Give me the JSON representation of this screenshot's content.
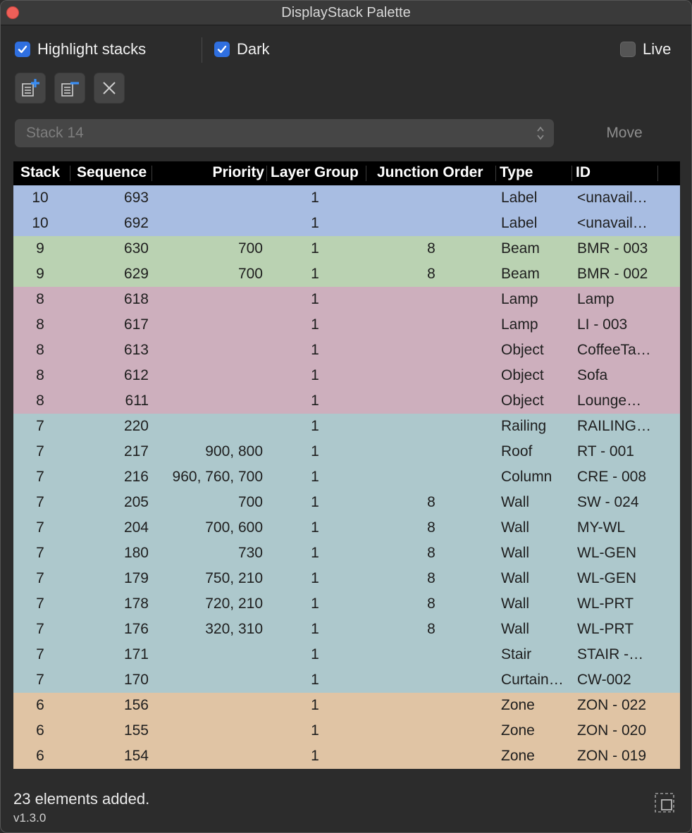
{
  "window": {
    "title": "DisplayStack Palette"
  },
  "options": {
    "highlight_stacks": {
      "label": "Highlight stacks",
      "checked": true
    },
    "dark": {
      "label": "Dark",
      "checked": true
    },
    "live": {
      "label": "Live",
      "checked": false
    }
  },
  "toolbar": {
    "add_icon": "add-to-stack-icon",
    "remove_icon": "remove-from-stack-icon",
    "clear_icon": "close-icon"
  },
  "stack_select": {
    "value": "Stack 14"
  },
  "move_button": {
    "label": "Move"
  },
  "table": {
    "columns": [
      "Stack",
      "Sequence",
      "Priority",
      "Layer Group",
      "Junction Order",
      "Type",
      "ID"
    ],
    "stack_colors": {
      "10": "#a8bde2",
      "9": "#bad2b2",
      "8": "#cdafbd",
      "7": "#adc8cc",
      "6": "#e0c4a4"
    },
    "rows": [
      {
        "stack": "10",
        "sequence": "693",
        "priority": "",
        "layer_group": "1",
        "junction_order": "",
        "type": "Label",
        "id": "<unavail…"
      },
      {
        "stack": "10",
        "sequence": "692",
        "priority": "",
        "layer_group": "1",
        "junction_order": "",
        "type": "Label",
        "id": "<unavail…"
      },
      {
        "stack": "9",
        "sequence": "630",
        "priority": "700",
        "layer_group": "1",
        "junction_order": "8",
        "type": "Beam",
        "id": "BMR - 003"
      },
      {
        "stack": "9",
        "sequence": "629",
        "priority": "700",
        "layer_group": "1",
        "junction_order": "8",
        "type": "Beam",
        "id": "BMR - 002"
      },
      {
        "stack": "8",
        "sequence": "618",
        "priority": "",
        "layer_group": "1",
        "junction_order": "",
        "type": "Lamp",
        "id": "Lamp"
      },
      {
        "stack": "8",
        "sequence": "617",
        "priority": "",
        "layer_group": "1",
        "junction_order": "",
        "type": "Lamp",
        "id": "LI - 003"
      },
      {
        "stack": "8",
        "sequence": "613",
        "priority": "",
        "layer_group": "1",
        "junction_order": "",
        "type": "Object",
        "id": "CoffeeTa…"
      },
      {
        "stack": "8",
        "sequence": "612",
        "priority": "",
        "layer_group": "1",
        "junction_order": "",
        "type": "Object",
        "id": "Sofa"
      },
      {
        "stack": "8",
        "sequence": "611",
        "priority": "",
        "layer_group": "1",
        "junction_order": "",
        "type": "Object",
        "id": "Lounge…"
      },
      {
        "stack": "7",
        "sequence": "220",
        "priority": "",
        "layer_group": "1",
        "junction_order": "",
        "type": "Railing",
        "id": "RAILING…"
      },
      {
        "stack": "7",
        "sequence": "217",
        "priority": "900, 800",
        "layer_group": "1",
        "junction_order": "",
        "type": "Roof",
        "id": "RT - 001"
      },
      {
        "stack": "7",
        "sequence": "216",
        "priority": "960, 760, 700",
        "layer_group": "1",
        "junction_order": "",
        "type": "Column",
        "id": "CRE - 008"
      },
      {
        "stack": "7",
        "sequence": "205",
        "priority": "700",
        "layer_group": "1",
        "junction_order": "8",
        "type": "Wall",
        "id": "SW - 024"
      },
      {
        "stack": "7",
        "sequence": "204",
        "priority": "700, 600",
        "layer_group": "1",
        "junction_order": "8",
        "type": "Wall",
        "id": "MY-WL"
      },
      {
        "stack": "7",
        "sequence": "180",
        "priority": "730",
        "layer_group": "1",
        "junction_order": "8",
        "type": "Wall",
        "id": "WL-GEN"
      },
      {
        "stack": "7",
        "sequence": "179",
        "priority": "750, 210",
        "layer_group": "1",
        "junction_order": "8",
        "type": "Wall",
        "id": "WL-GEN"
      },
      {
        "stack": "7",
        "sequence": "178",
        "priority": "720, 210",
        "layer_group": "1",
        "junction_order": "8",
        "type": "Wall",
        "id": "WL-PRT"
      },
      {
        "stack": "7",
        "sequence": "176",
        "priority": "320, 310",
        "layer_group": "1",
        "junction_order": "8",
        "type": "Wall",
        "id": "WL-PRT"
      },
      {
        "stack": "7",
        "sequence": "171",
        "priority": "",
        "layer_group": "1",
        "junction_order": "",
        "type": "Stair",
        "id": "STAIR -…"
      },
      {
        "stack": "7",
        "sequence": "170",
        "priority": "",
        "layer_group": "1",
        "junction_order": "",
        "type": "Curtain…",
        "id": "CW-002"
      },
      {
        "stack": "6",
        "sequence": "156",
        "priority": "",
        "layer_group": "1",
        "junction_order": "",
        "type": "Zone",
        "id": "ZON - 022"
      },
      {
        "stack": "6",
        "sequence": "155",
        "priority": "",
        "layer_group": "1",
        "junction_order": "",
        "type": "Zone",
        "id": "ZON - 020"
      },
      {
        "stack": "6",
        "sequence": "154",
        "priority": "",
        "layer_group": "1",
        "junction_order": "",
        "type": "Zone",
        "id": "ZON - 019"
      }
    ]
  },
  "status": {
    "message": "23 elements added.",
    "version": "v1.3.0"
  }
}
